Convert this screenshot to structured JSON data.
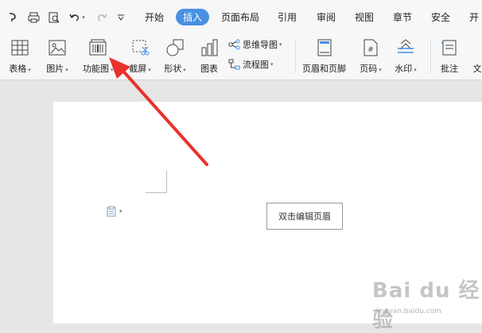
{
  "menu": {
    "tabs": [
      {
        "label": "开始"
      },
      {
        "label": "插入"
      },
      {
        "label": "页面布局"
      },
      {
        "label": "引用"
      },
      {
        "label": "审阅"
      },
      {
        "label": "视图"
      },
      {
        "label": "章节"
      },
      {
        "label": "安全"
      },
      {
        "label": "开"
      }
    ]
  },
  "ribbon": {
    "buttons": [
      {
        "label": "表格"
      },
      {
        "label": "图片"
      },
      {
        "label": "功能图"
      },
      {
        "label": "截屏"
      },
      {
        "label": "形状"
      },
      {
        "label": "图表"
      },
      {
        "label": "页眉和页脚"
      },
      {
        "label": "页码"
      },
      {
        "label": "水印"
      },
      {
        "label": "批注"
      },
      {
        "label": "文"
      }
    ],
    "small": [
      {
        "label": "思维导图"
      },
      {
        "label": "流程图"
      }
    ]
  },
  "document": {
    "header_hint": "双击编辑页眉"
  },
  "watermark": {
    "logo": "Bai du 经验",
    "url": "jingyan.baidu.com"
  },
  "colors": {
    "accent": "#4a90e2",
    "arrow": "#e8322a"
  }
}
